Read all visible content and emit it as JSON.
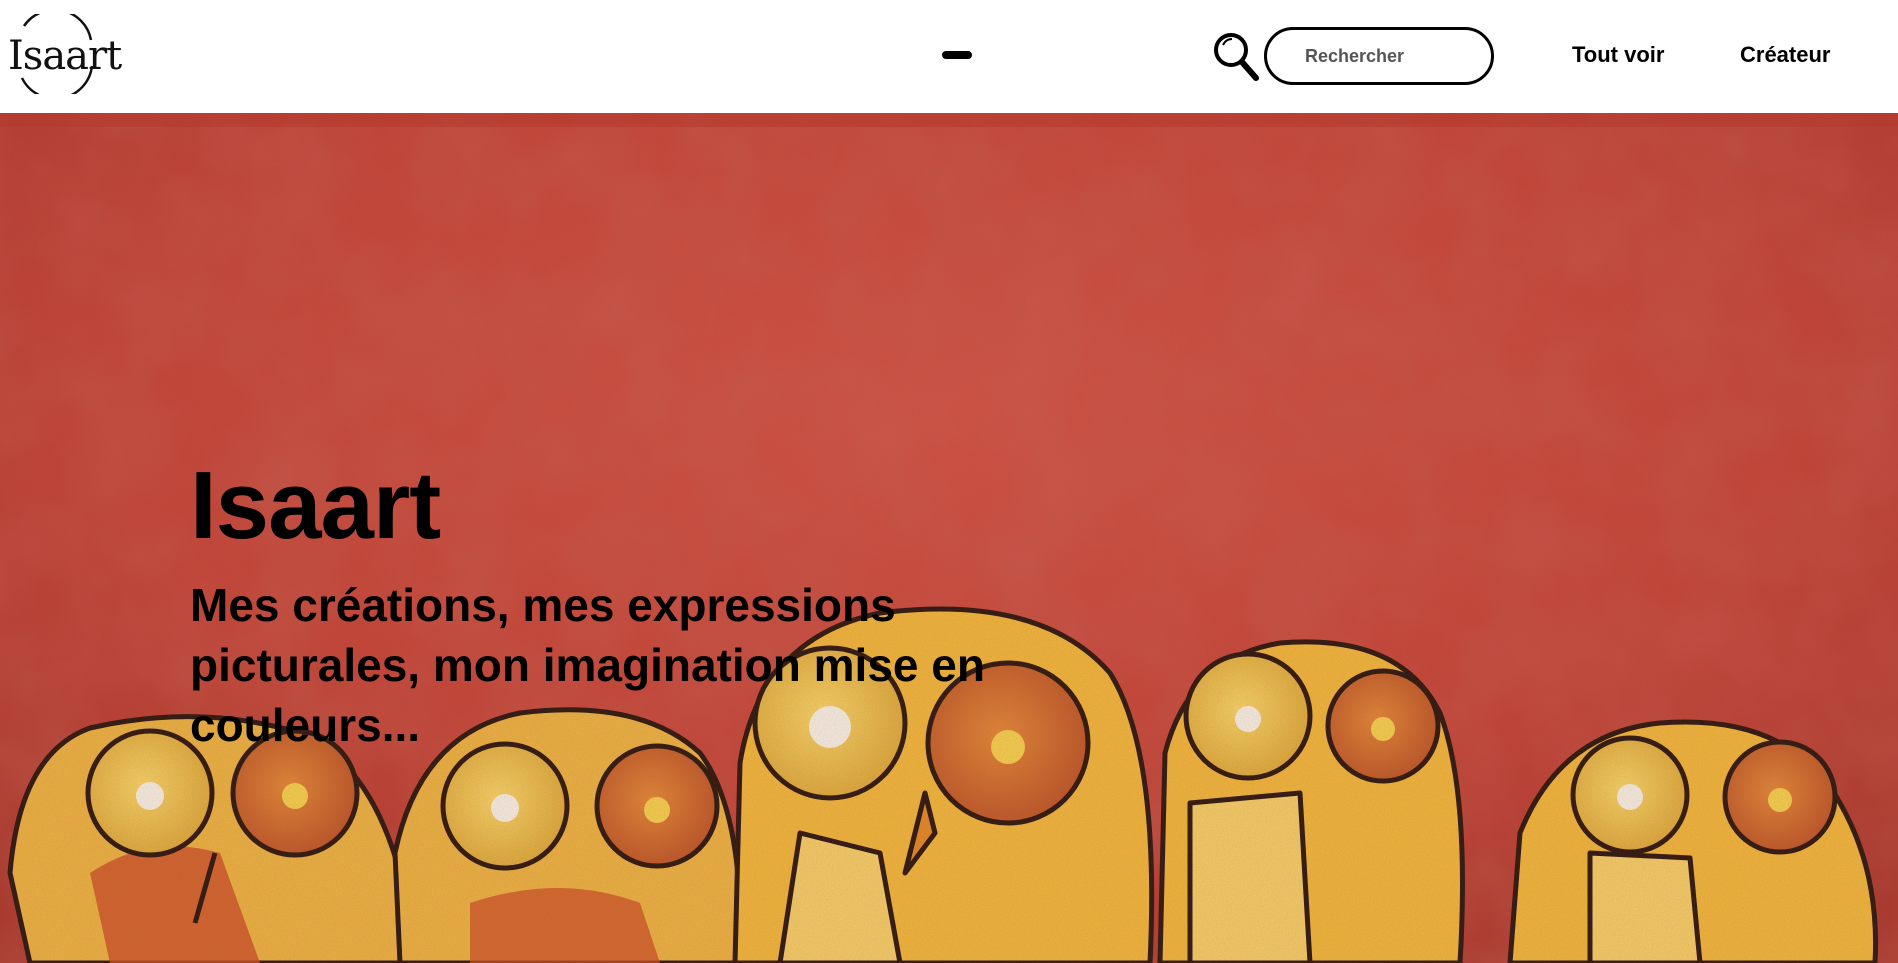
{
  "header": {
    "logo_text": "Isaart",
    "search": {
      "placeholder": "Rechercher"
    },
    "nav": {
      "all_label": "Tout voir",
      "creator_label": "Créateur"
    }
  },
  "hero": {
    "title": "Isaart",
    "tagline": "Mes créations, mes expressions picturales, mon imagination mise en couleurs..."
  },
  "colors": {
    "header_bg": "#ffffff",
    "painting_red": "#c8463a",
    "owl_yellow": "#f2b83a",
    "owl_orange": "#d9702a",
    "text": "#000000"
  },
  "icons": {
    "search": "search-icon",
    "menu": "menu-dash-icon"
  }
}
